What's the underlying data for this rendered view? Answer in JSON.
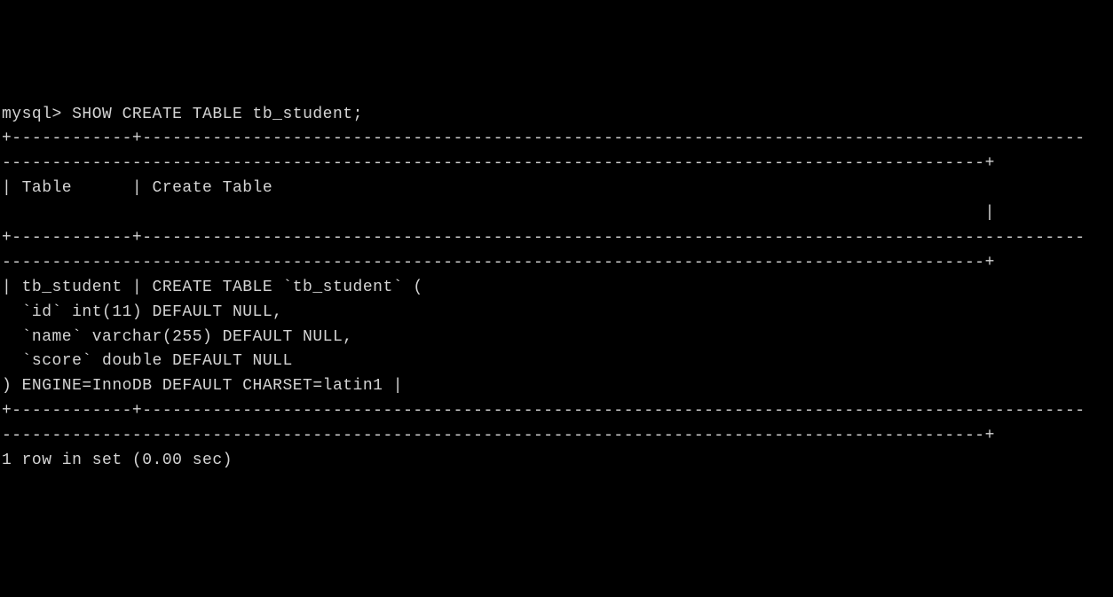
{
  "terminal": {
    "prompt": "mysql> ",
    "command": "SHOW CREATE TABLE tb_student;",
    "divider_top1": "+------------+----------------------------------------------------------------------------------------------",
    "divider_top2": "--------------------------------------------------------------------------------------------------+",
    "header_line1": "| Table      | Create Table",
    "header_line2": "                                                                                                  |",
    "divider_mid1": "+------------+----------------------------------------------------------------------------------------------",
    "divider_mid2": "--------------------------------------------------------------------------------------------------+",
    "row_line1": "| tb_student | CREATE TABLE `tb_student` (",
    "row_line2": "  `id` int(11) DEFAULT NULL,",
    "row_line3": "  `name` varchar(255) DEFAULT NULL,",
    "row_line4": "  `score` double DEFAULT NULL",
    "row_line5": ") ENGINE=InnoDB DEFAULT CHARSET=latin1 |",
    "divider_bot1": "+------------+----------------------------------------------------------------------------------------------",
    "divider_bot2": "--------------------------------------------------------------------------------------------------+",
    "result": "1 row in set (0.00 sec)"
  }
}
